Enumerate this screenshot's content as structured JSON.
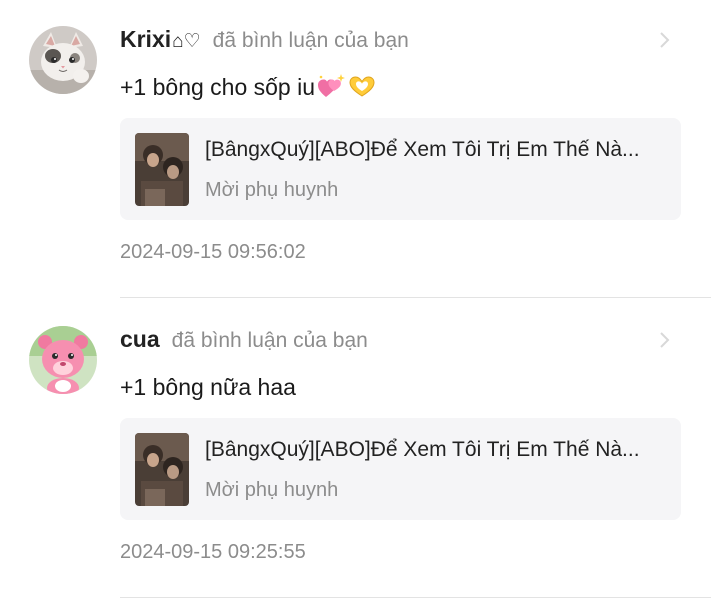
{
  "notifications": [
    {
      "user": "Krixi",
      "user_decor": "⌂♡",
      "action": "đã bình luận của bạn",
      "comment": "+1 bông cho sốp iu",
      "comment_emojis": [
        "heart-sparkle-icon",
        "heart-hands-icon"
      ],
      "avatar": "cat-avatar-icon",
      "book_title": "[BângxQuý][ABO]Để Xem Tôi Trị Em Thế Nà...",
      "book_subtitle": "Mời phụ huynh",
      "timestamp": "2024-09-15 09:56:02"
    },
    {
      "user": "cua",
      "user_decor": "",
      "action": "đã bình luận của bạn",
      "comment": "+1 bông nữa haa",
      "comment_emojis": [],
      "avatar": "pink-bear-avatar-icon",
      "book_title": "[BângxQuý][ABO]Để Xem Tôi Trị Em Thế Nà...",
      "book_subtitle": "Mời phụ huynh",
      "timestamp": "2024-09-15 09:25:55"
    }
  ],
  "icons": {
    "chevron": "chevron-right-icon"
  },
  "colors": {
    "muted_text": "#8c8c8c",
    "card_bg": "#f5f5f7",
    "divider": "#e3e3e3"
  }
}
